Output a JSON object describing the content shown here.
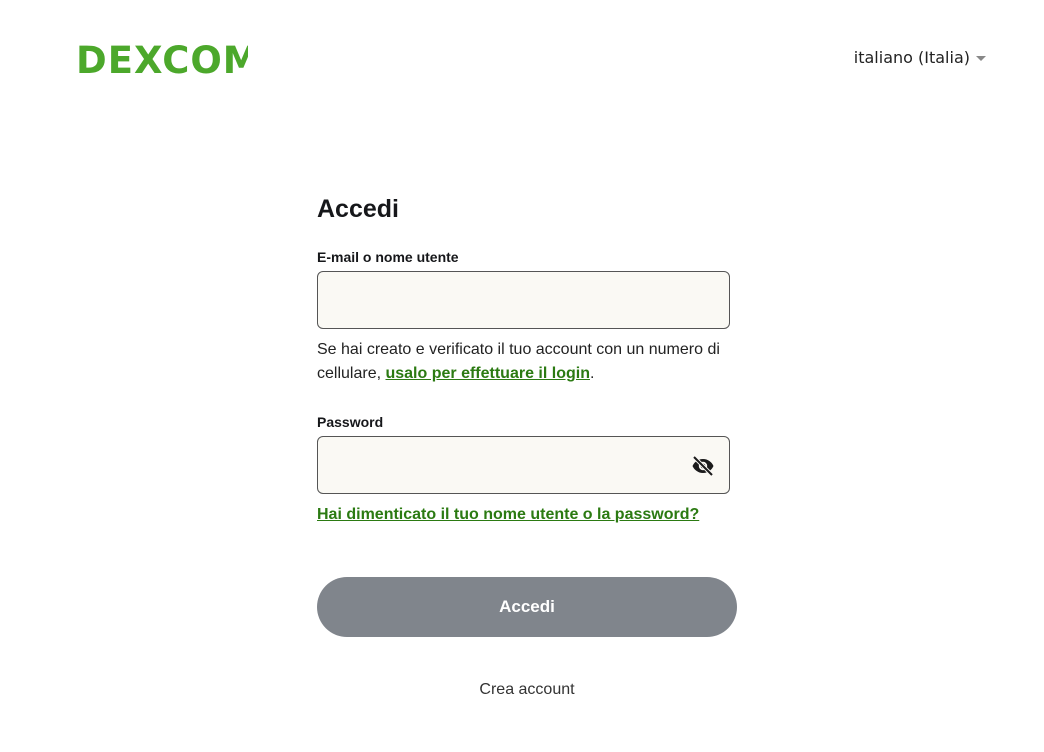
{
  "header": {
    "logo_text": "DEXCOM",
    "language": "italiano (Italia)"
  },
  "form": {
    "title": "Accedi",
    "email_label": "E-mail o nome utente",
    "email_value": "",
    "help_text_prefix": "Se hai creato e verificato il tuo account con un numero di cellulare, ",
    "help_link": "usalo per effettuare il login",
    "help_text_suffix": ".",
    "password_label": "Password",
    "password_value": "",
    "forgot_link": "Hai dimenticato il tuo nome utente o la password?",
    "submit_label": "Accedi",
    "create_account_label": "Crea account"
  },
  "icons": {
    "password_toggle": "eye-slash-icon",
    "language_caret": "caret-down-icon"
  },
  "colors": {
    "brand": "#4ca82b",
    "link": "#2b7a12",
    "button_disabled": "#80858c",
    "input_bg": "#faf9f4"
  }
}
